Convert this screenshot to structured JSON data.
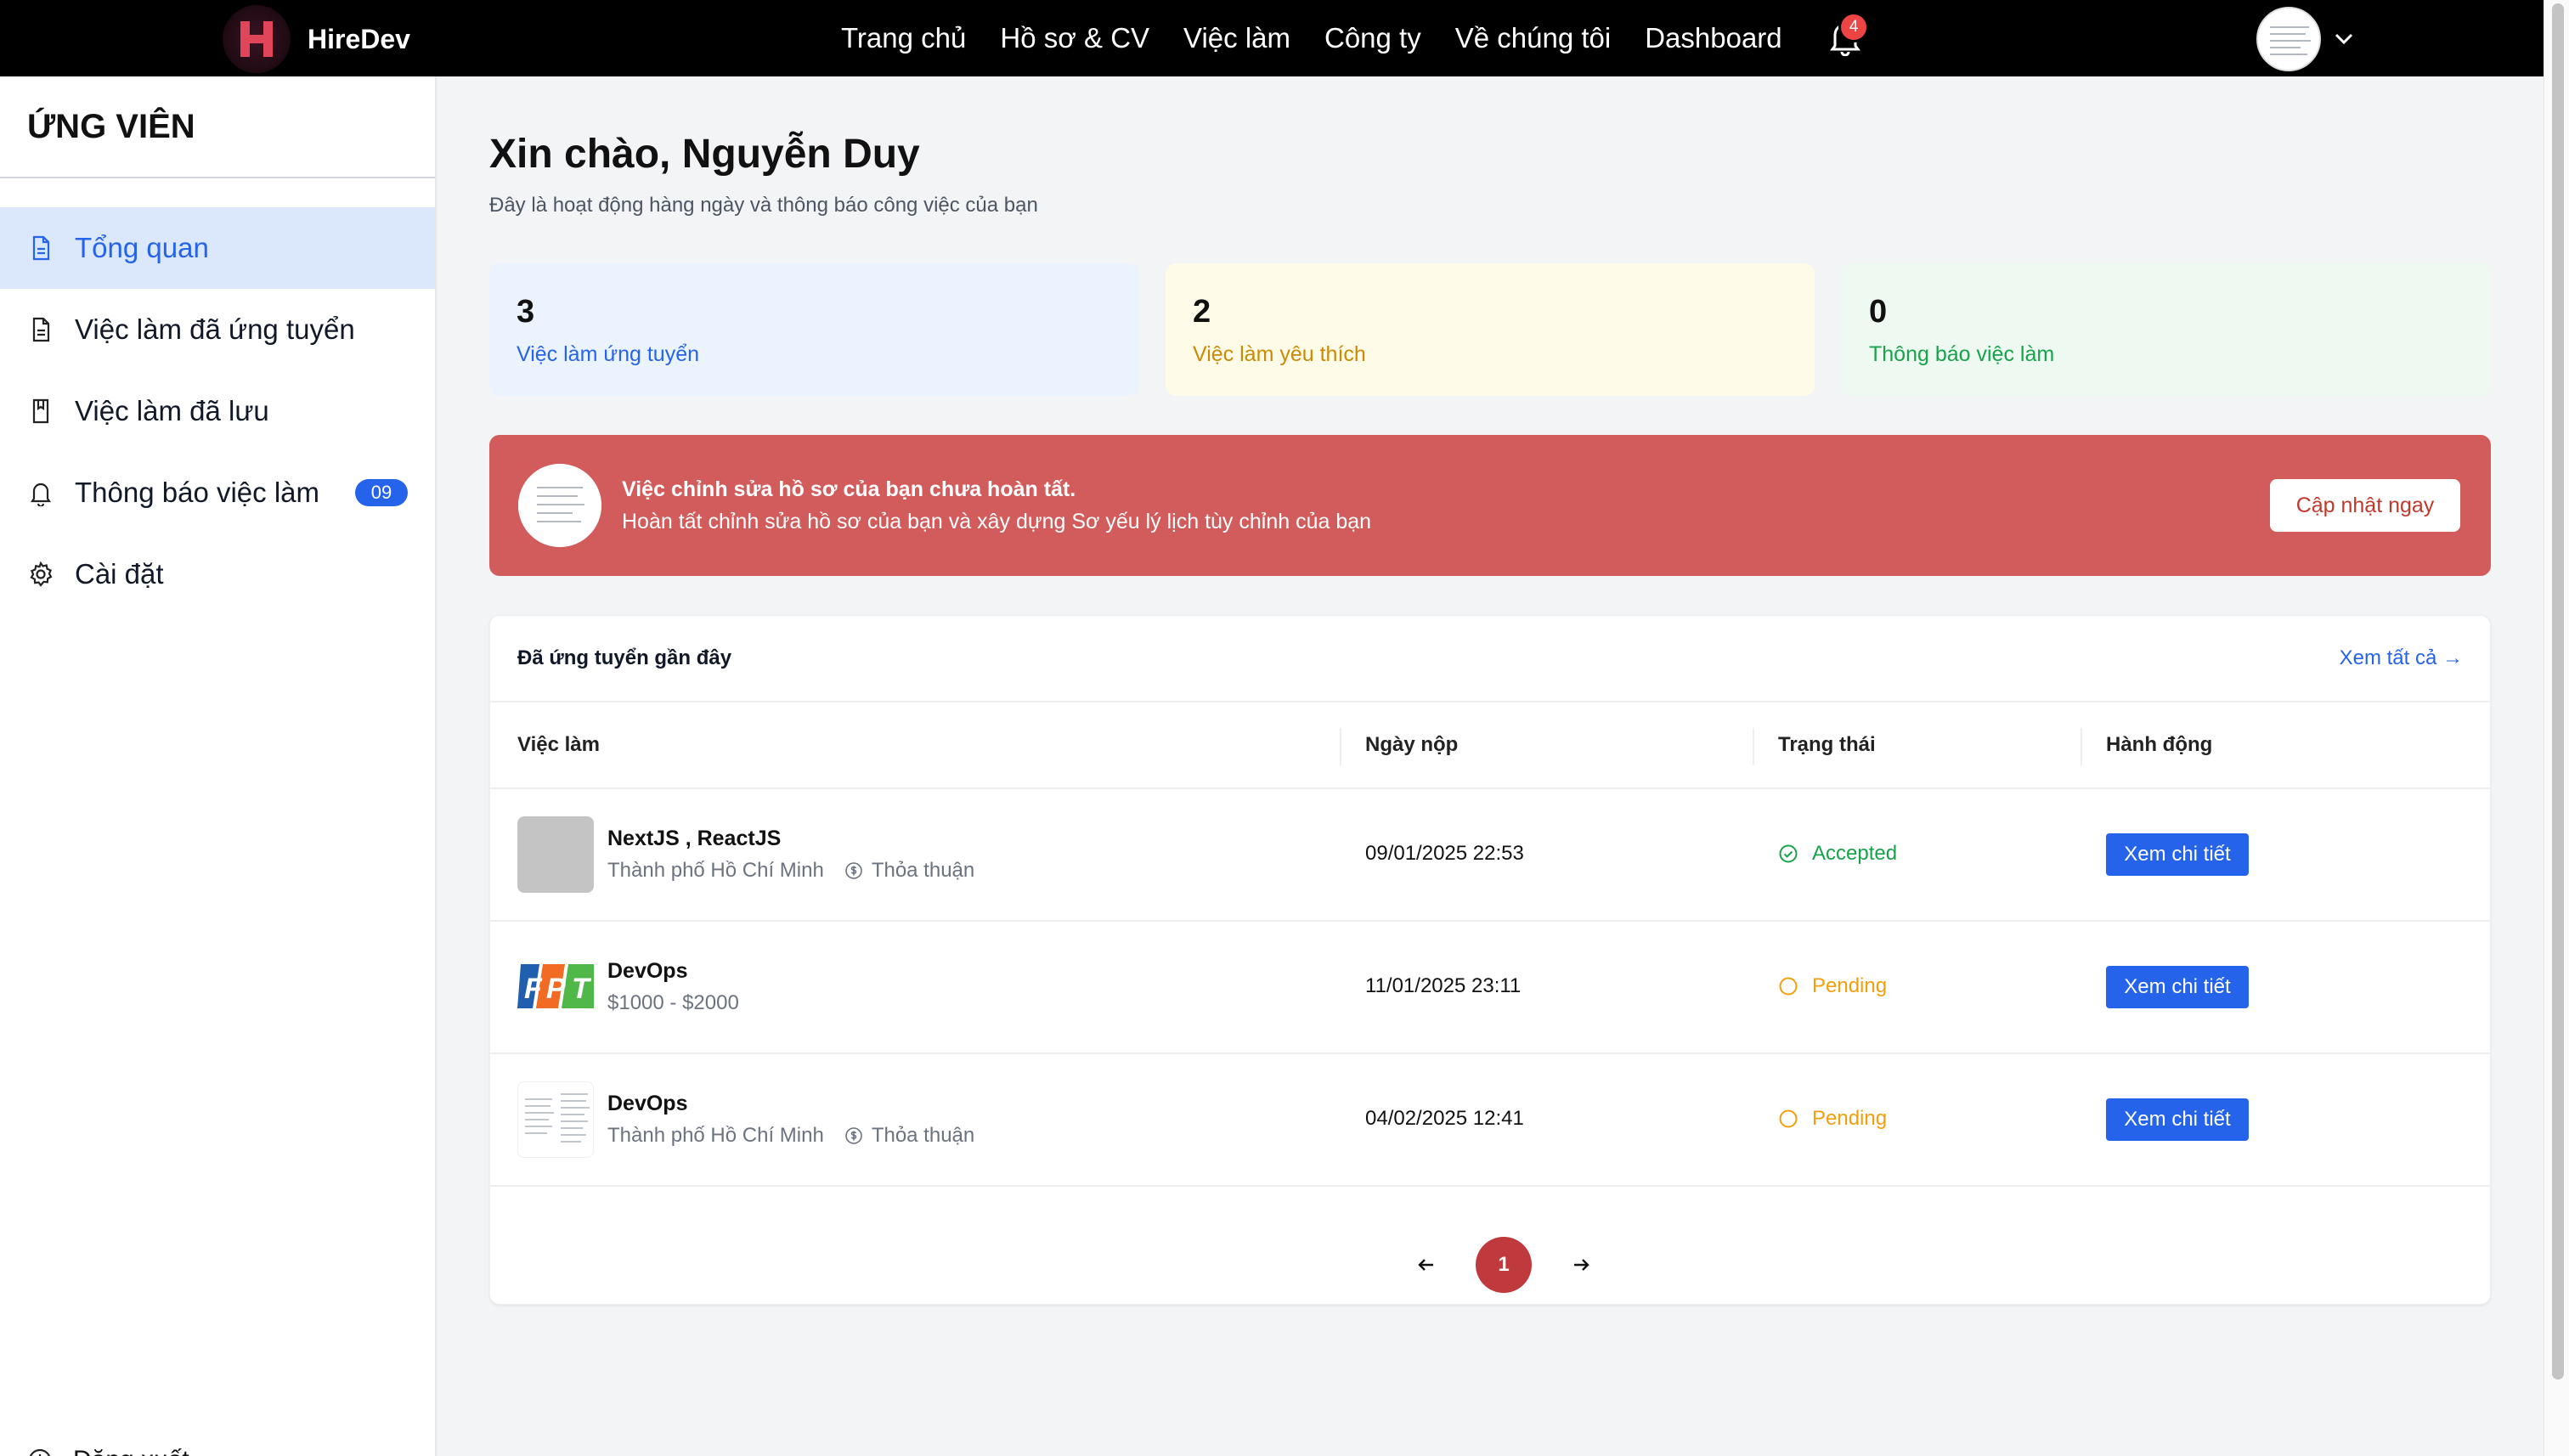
{
  "header": {
    "brand": "HireDev",
    "nav": [
      "Trang chủ",
      "Hồ sơ & CV",
      "Việc làm",
      "Công ty",
      "Về chúng tôi",
      "Dashboard"
    ],
    "notification_count": "4"
  },
  "sidebar": {
    "title": "ỨNG VIÊN",
    "items": [
      {
        "label": "Tổng quan",
        "icon": "document-icon",
        "active": true
      },
      {
        "label": "Việc làm đã ứng tuyển",
        "icon": "document-icon"
      },
      {
        "label": "Việc làm đã lưu",
        "icon": "bookmark-icon"
      },
      {
        "label": "Thông báo việc làm",
        "icon": "bell-icon",
        "badge": "09"
      },
      {
        "label": "Cài đặt",
        "icon": "gear-icon"
      }
    ],
    "logout": "Đăng xuất"
  },
  "main": {
    "greeting": "Xin chào, Nguyễn Duy",
    "subtitle": "Đây là hoạt động hàng ngày và thông báo công việc của bạn",
    "stats": [
      {
        "value": "3",
        "label": "Việc làm ứng tuyển"
      },
      {
        "value": "2",
        "label": "Việc làm yêu thích"
      },
      {
        "value": "0",
        "label": "Thông báo việc làm"
      }
    ],
    "alert": {
      "title": "Việc chỉnh sửa hồ sơ của bạn chưa hoàn tất.",
      "description": "Hoàn tất chỉnh sửa hồ sơ của bạn và xây dựng Sơ yếu lý lịch tùy chỉnh của bạn",
      "button": "Cập nhật ngay"
    },
    "recent": {
      "title": "Đã ứng tuyển gần đây",
      "view_all": "Xem tất cả →",
      "columns": [
        "Việc làm",
        "Ngày nộp",
        "Trạng thái",
        "Hành động"
      ],
      "rows": [
        {
          "title": "NextJS , ReactJS",
          "location": "Thành phố Hồ Chí Minh",
          "salary": "Thỏa thuận",
          "date": "09/01/2025 22:53",
          "status": "Accepted",
          "action": "Xem chi tiết"
        },
        {
          "title": "DevOps",
          "location": "$1000 - $2000",
          "salary": "",
          "date": "11/01/2025 23:11",
          "status": "Pending",
          "action": "Xem chi tiết"
        },
        {
          "title": "DevOps",
          "location": "Thành phố Hồ Chí Minh",
          "salary": "Thỏa thuận",
          "date": "04/02/2025 12:41",
          "status": "Pending",
          "action": "Xem chi tiết"
        }
      ]
    },
    "pagination": {
      "current": "1"
    }
  },
  "colors": {
    "primary": "#2563eb",
    "alert": "#d25c5c",
    "accepted": "#16a34a",
    "pending": "#f59e0b",
    "page_active": "#c0393c"
  }
}
